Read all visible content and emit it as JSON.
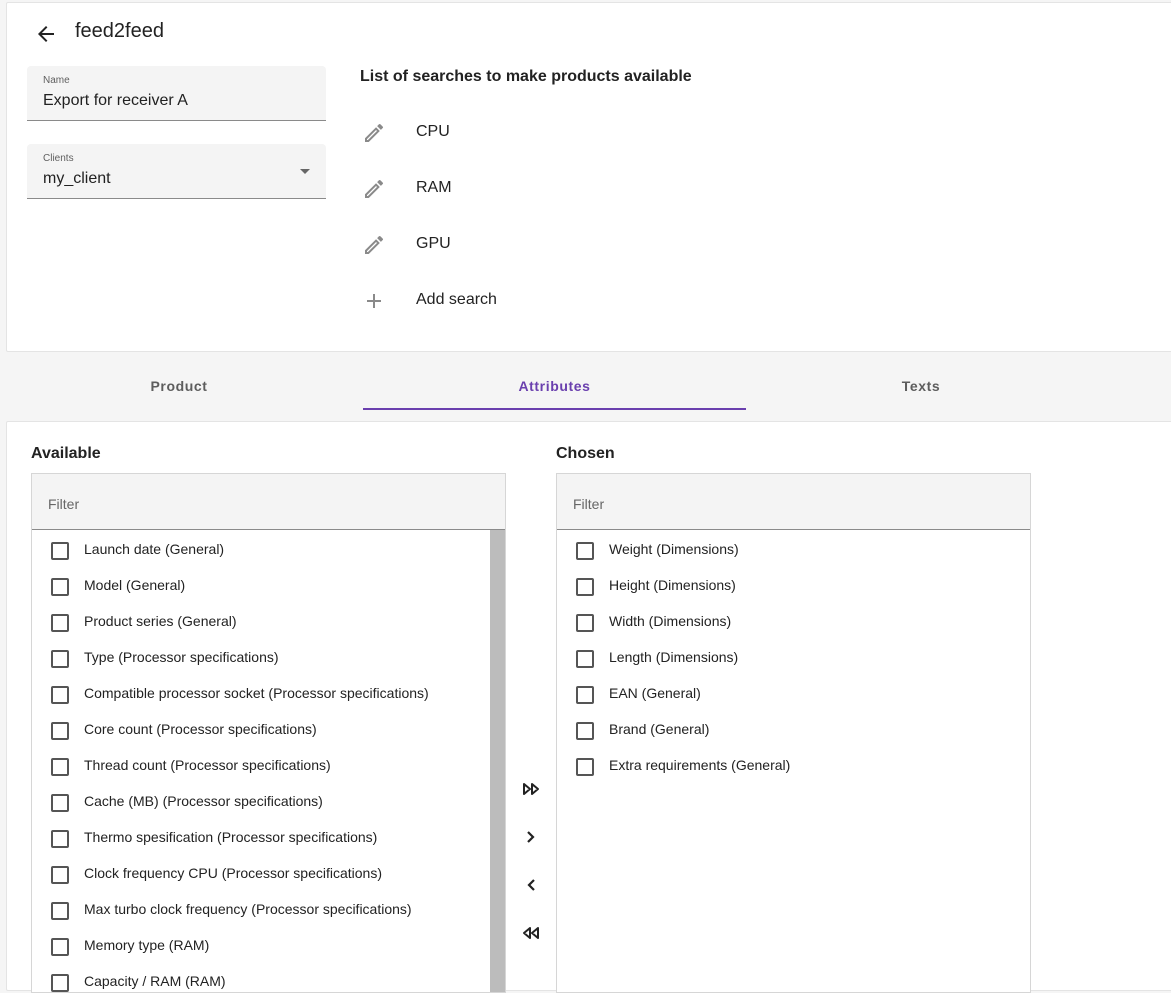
{
  "header": {
    "title": "feed2feed",
    "back_icon": "arrow-left-icon"
  },
  "form": {
    "name": {
      "label": "Name",
      "value": "Export for receiver A"
    },
    "clients": {
      "label": "Clients",
      "value": "my_client"
    }
  },
  "searches": {
    "title": "List of searches to make products available",
    "items": [
      {
        "label": "CPU",
        "icon": "pencil-icon"
      },
      {
        "label": "RAM",
        "icon": "pencil-icon"
      },
      {
        "label": "GPU",
        "icon": "pencil-icon"
      }
    ],
    "add_label": "Add search"
  },
  "tabs": [
    {
      "label": "Product"
    },
    {
      "label": "Attributes",
      "active": true
    },
    {
      "label": "Texts"
    }
  ],
  "available": {
    "title": "Available",
    "filter_placeholder": "Filter",
    "items": [
      "Launch date (General)",
      "Model (General)",
      "Product series (General)",
      "Type (Processor specifications)",
      "Compatible processor socket (Processor specifications)",
      "Core count (Processor specifications)",
      "Thread count (Processor specifications)",
      "Cache (MB) (Processor specifications)",
      "Thermo spesification (Processor specifications)",
      "Clock frequency CPU (Processor specifications)",
      "Max turbo clock frequency (Processor specifications)",
      "Memory type (RAM)",
      "Capacity / RAM (RAM)"
    ]
  },
  "chosen": {
    "title": "Chosen",
    "filter_placeholder": "Filter",
    "items": [
      "Weight (Dimensions)",
      "Height (Dimensions)",
      "Width (Dimensions)",
      "Length (Dimensions)",
      "EAN (General)",
      "Brand (General)",
      "Extra requirements (General)"
    ]
  },
  "transfer_buttons": [
    {
      "name": "move-all-right-button",
      "icon": "double-chevron-right-icon"
    },
    {
      "name": "move-right-button",
      "icon": "chevron-right-icon"
    },
    {
      "name": "move-left-button",
      "icon": "chevron-left-icon"
    },
    {
      "name": "move-all-left-button",
      "icon": "double-chevron-left-icon"
    }
  ],
  "colors": {
    "accent": "#6a3fae"
  }
}
